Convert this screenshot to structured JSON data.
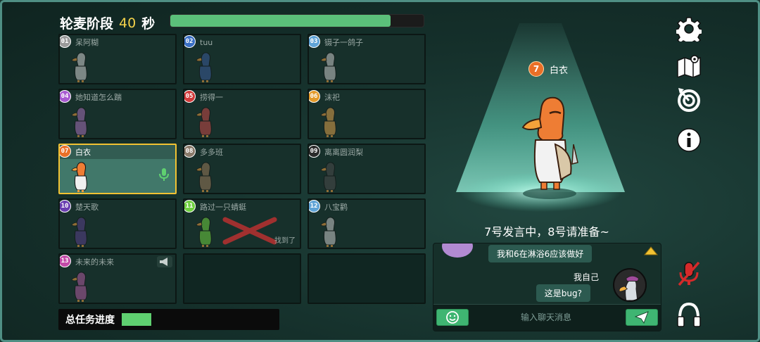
{
  "header": {
    "phase_label": "轮麦阶段",
    "seconds_left": "40",
    "seconds_unit": "秒",
    "timer_progress": 0.87
  },
  "players": [
    {
      "number": "01",
      "name": "呆阿糊",
      "badge_color": "#9a9a9a",
      "goose_color": "#cfcfcf",
      "active": false,
      "empty": false
    },
    {
      "number": "02",
      "name": "tuu",
      "badge_color": "#3a6fc4",
      "goose_color": "#3a5a98",
      "active": false,
      "empty": false
    },
    {
      "number": "03",
      "name": "镊子一鸽子",
      "badge_color": "#5fa3d6",
      "goose_color": "#c8c8c8",
      "active": false,
      "empty": false
    },
    {
      "number": "04",
      "name": "她知道怎么踹",
      "badge_color": "#a75ad0",
      "goose_color": "#a66fb8",
      "active": false,
      "empty": false
    },
    {
      "number": "05",
      "name": "捞得一",
      "badge_color": "#d23a3a",
      "goose_color": "#c84848",
      "active": false,
      "empty": false
    },
    {
      "number": "06",
      "name": "沫祀",
      "badge_color": "#e39a2a",
      "goose_color": "#e0a24a",
      "active": false,
      "empty": false
    },
    {
      "number": "07",
      "name": "白衣",
      "badge_color": "#e96f27",
      "goose_color": "#ee7d34",
      "active": true,
      "empty": false,
      "speaking": true
    },
    {
      "number": "08",
      "name": "多多班",
      "badge_color": "#8a7a6a",
      "goose_color": "#9a7a5a",
      "active": false,
      "empty": false
    },
    {
      "number": "09",
      "name": "离离圆润梨",
      "badge_color": "#2a2a2a",
      "goose_color": "#4a4a4a",
      "active": false,
      "empty": false
    },
    {
      "number": "10",
      "name": "楚天歌",
      "badge_color": "#6a3fb0",
      "goose_color": "#5a3f8a",
      "active": false,
      "empty": false
    },
    {
      "number": "11",
      "name": "路过一只蜻蜓",
      "badge_color": "#6fd040",
      "goose_color": "#6fd040",
      "active": false,
      "empty": false,
      "dead": true,
      "found_label": "找到了"
    },
    {
      "number": "12",
      "name": "八宝鹳",
      "badge_color": "#5fa3d6",
      "goose_color": "#c8c8c8",
      "active": false,
      "empty": false
    },
    {
      "number": "13",
      "name": "未来的未来",
      "badge_color": "#c24aa8",
      "goose_color": "#b05aa0",
      "active": false,
      "empty": false,
      "muted_horn": true
    },
    {
      "empty": true
    },
    {
      "empty": true
    }
  ],
  "task_progress": {
    "label": "总任务进度",
    "value": 0.19
  },
  "speaker": {
    "number": "7",
    "name": "白衣",
    "status": "7号发言中，8号请准备~"
  },
  "chat": {
    "messages": [
      {
        "text": "我和6在淋浴6应该做好",
        "self": false
      },
      {
        "sender": "我自己",
        "text": "这是bug?",
        "self": true
      }
    ],
    "input_placeholder": "输入聊天消息"
  },
  "colors": {
    "accent_green": "#3fb572",
    "highlight_border": "#f1c232",
    "progress_green": "#5fd070"
  },
  "side_icons": [
    "gear-icon",
    "map-icon",
    "target-icon",
    "info-icon",
    "mic-off-icon",
    "headphones-icon"
  ]
}
